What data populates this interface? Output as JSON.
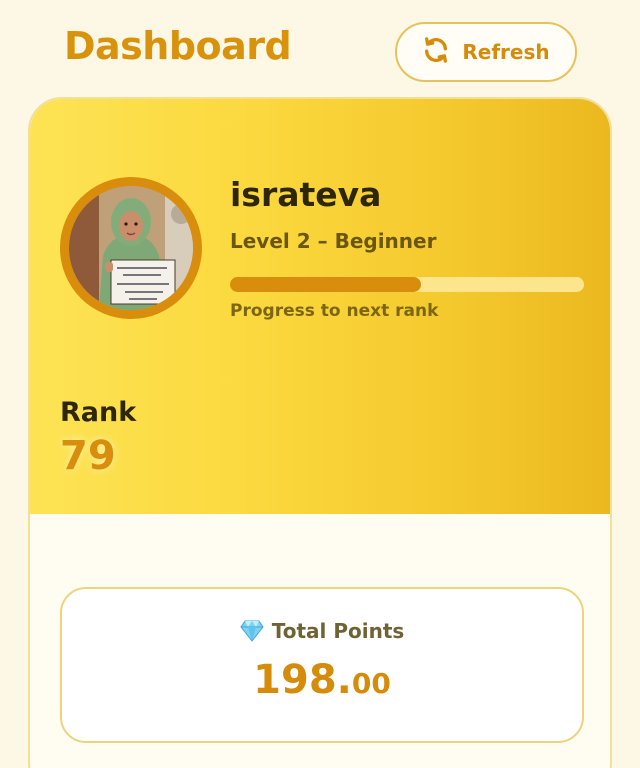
{
  "header": {
    "title": "Dashboard",
    "refresh_label": "Refresh"
  },
  "profile": {
    "username": "israteva",
    "level": "Level 2 – Beginner",
    "progress_fraction": 0.54,
    "progress_caption": "Progress to next rank",
    "rank_label": "Rank",
    "rank_value": "79",
    "photo_sign_lines": [
      "মো: ইসরাত জাহান",
      "গাইবান্ধা",
      "০১৭২৪ ৫৫৬",
      "১৭-৭-২৩"
    ]
  },
  "points": {
    "label": "Total Points",
    "integer_part": "198.",
    "decimal_part": "00",
    "icon": "gem-icon"
  },
  "colors": {
    "accent": "#d98d0c",
    "hero_gradient_start": "#fde354",
    "hero_gradient_end": "#ebb81f",
    "page_bg": "#fdf8e6"
  }
}
